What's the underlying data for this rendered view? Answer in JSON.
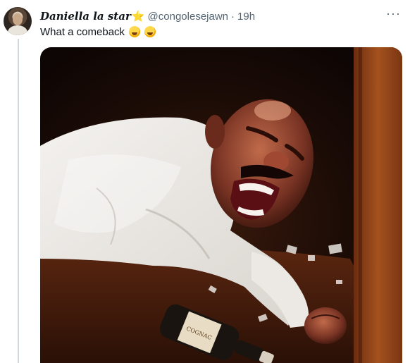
{
  "tweet": {
    "display_name": "Daniella la star",
    "star": "⭐",
    "handle": "@congolesejawn",
    "separator": "·",
    "time": "19h",
    "text": "What a comeback",
    "emojis": [
      "rolling-on-floor-laughing-emoji",
      "rolling-on-floor-laughing-emoji"
    ],
    "more_glyph": "···"
  },
  "media": {
    "type": "photo",
    "icon": "photo",
    "bottle_label": "COGNAC"
  },
  "colors": {
    "text_primary": "#0f1419",
    "text_secondary": "#536471",
    "thread_line": "#cfd9de",
    "star": "#f5a623"
  }
}
